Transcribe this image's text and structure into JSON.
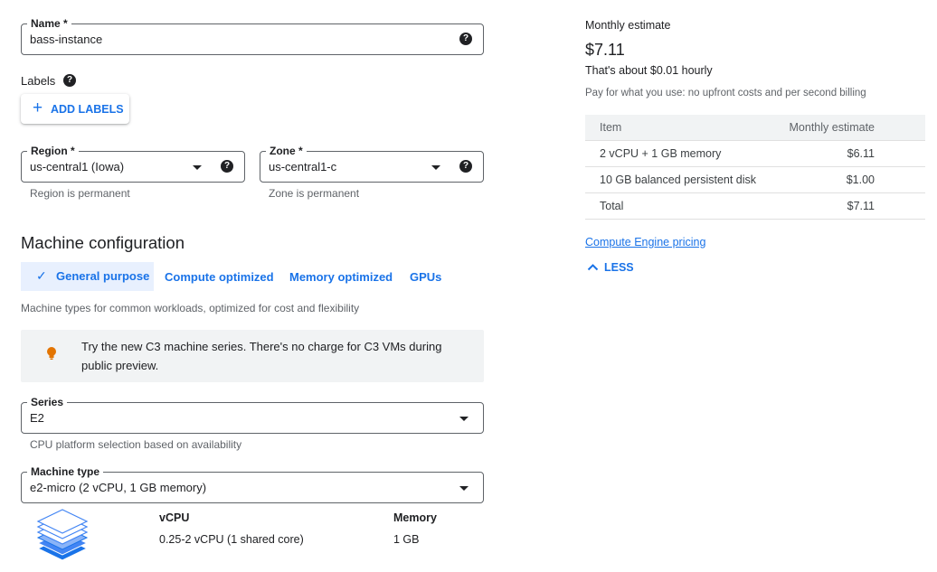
{
  "name_field": {
    "label": "Name *",
    "value": "bass-instance"
  },
  "labels": {
    "heading": "Labels",
    "add_button": "ADD LABELS"
  },
  "region": {
    "label": "Region *",
    "value": "us-central1 (Iowa)",
    "hint": "Region is permanent"
  },
  "zone": {
    "label": "Zone *",
    "value": "us-central1-c",
    "hint": "Zone is permanent"
  },
  "machine_config": {
    "title": "Machine configuration",
    "tabs": [
      {
        "label": "General purpose",
        "selected": true
      },
      {
        "label": "Compute optimized"
      },
      {
        "label": "Memory optimized"
      },
      {
        "label": "GPUs"
      }
    ],
    "description": "Machine types for common workloads, optimized for cost and flexibility",
    "tip_line1": "Try the new C3 machine series. There's no charge for C3 VMs during",
    "tip_line2": "public preview.",
    "series": {
      "label": "Series",
      "value": "E2",
      "hint": "CPU platform selection based on availability"
    },
    "machine_type": {
      "label": "Machine type",
      "value": "e2-micro (2 vCPU, 1 GB memory)"
    },
    "specs": {
      "vcpu_header": "vCPU",
      "vcpu_value": "0.25-2 vCPU (1 shared core)",
      "memory_header": "Memory",
      "memory_value": "1 GB"
    }
  },
  "estimate": {
    "title": "Monthly estimate",
    "price": "$7.11",
    "hourly": "That's about $0.01 hourly",
    "note": "Pay for what you use: no upfront costs and per second billing",
    "table_headers": [
      "Item",
      "Monthly estimate"
    ],
    "rows": [
      {
        "item": "2 vCPU + 1 GB memory",
        "cost": "$6.11"
      },
      {
        "item": "10 GB balanced persistent disk",
        "cost": "$1.00"
      },
      {
        "item": "Total",
        "cost": "$7.11"
      }
    ],
    "pricing_link": "Compute Engine pricing",
    "less_button": "LESS"
  },
  "colors": {
    "accent": "#1a73e8",
    "tip_icon": "#e37400",
    "selected_tab_bg": "#e8f0fe"
  }
}
